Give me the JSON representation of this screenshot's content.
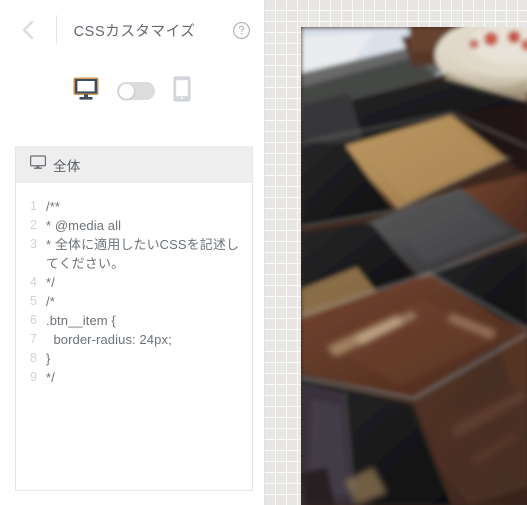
{
  "panel": {
    "title": "CSSカスタマイズ",
    "back_icon": "chevron-left-icon",
    "help_icon": "help-circle-icon"
  },
  "device_toggle": {
    "desktop_icon": "desktop-monitor-icon",
    "mobile_icon": "mobile-phone-icon",
    "switch_state": "off",
    "active_device": "desktop"
  },
  "editor": {
    "section_icon": "desktop-monitor-icon",
    "section_label": "全体",
    "lines": [
      {
        "number": "1",
        "text": "/**"
      },
      {
        "number": "2",
        "text": "* @media all"
      },
      {
        "number": "3",
        "text": "* 全体に適用したいCSSを記述してください。"
      },
      {
        "number": "4",
        "text": "*/"
      },
      {
        "number": "5",
        "text": "/*"
      },
      {
        "number": "6",
        "text": ".btn__item {"
      },
      {
        "number": "7",
        "text": "  border-radius: 24px;"
      },
      {
        "number": "8",
        "text": "}"
      },
      {
        "number": "9",
        "text": "*/"
      }
    ]
  },
  "preview": {
    "background": "grid-paper",
    "photo_alt": "floor-tiles-photo"
  },
  "colors": {
    "title_text": "#62696f",
    "muted_text": "#6d7378",
    "line_number": "#cfd3d6",
    "section_header_bg": "#eeeeee",
    "device_active": "#3d4c5e",
    "device_accent": "#d39a56",
    "device_inactive": "#d4d7db",
    "switch_track": "#dcdcdc",
    "grid_bg": "#e8e6e2",
    "panel_border": "#e6e6e6"
  }
}
